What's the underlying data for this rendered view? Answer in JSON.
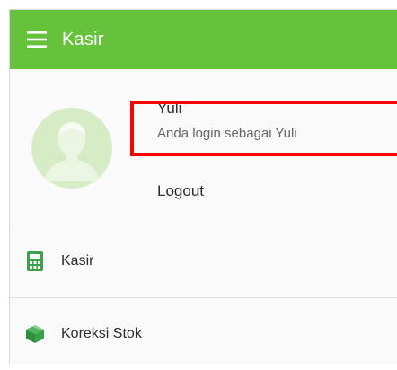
{
  "app_bar": {
    "title": "Kasir",
    "menu_icon": "hamburger-menu-icon",
    "color": "#66c23a"
  },
  "profile": {
    "avatar_icon": "user-avatar-icon",
    "name": "Yuli",
    "status": "Anda login sebagai Yuli",
    "logout_label": "Logout"
  },
  "nav": {
    "items": [
      {
        "label": "Kasir",
        "icon": "calculator-icon"
      },
      {
        "label": "Koreksi Stok",
        "icon": "box-icon"
      }
    ]
  },
  "colors": {
    "accent": "#66c23a",
    "highlight": "#ff0000"
  }
}
